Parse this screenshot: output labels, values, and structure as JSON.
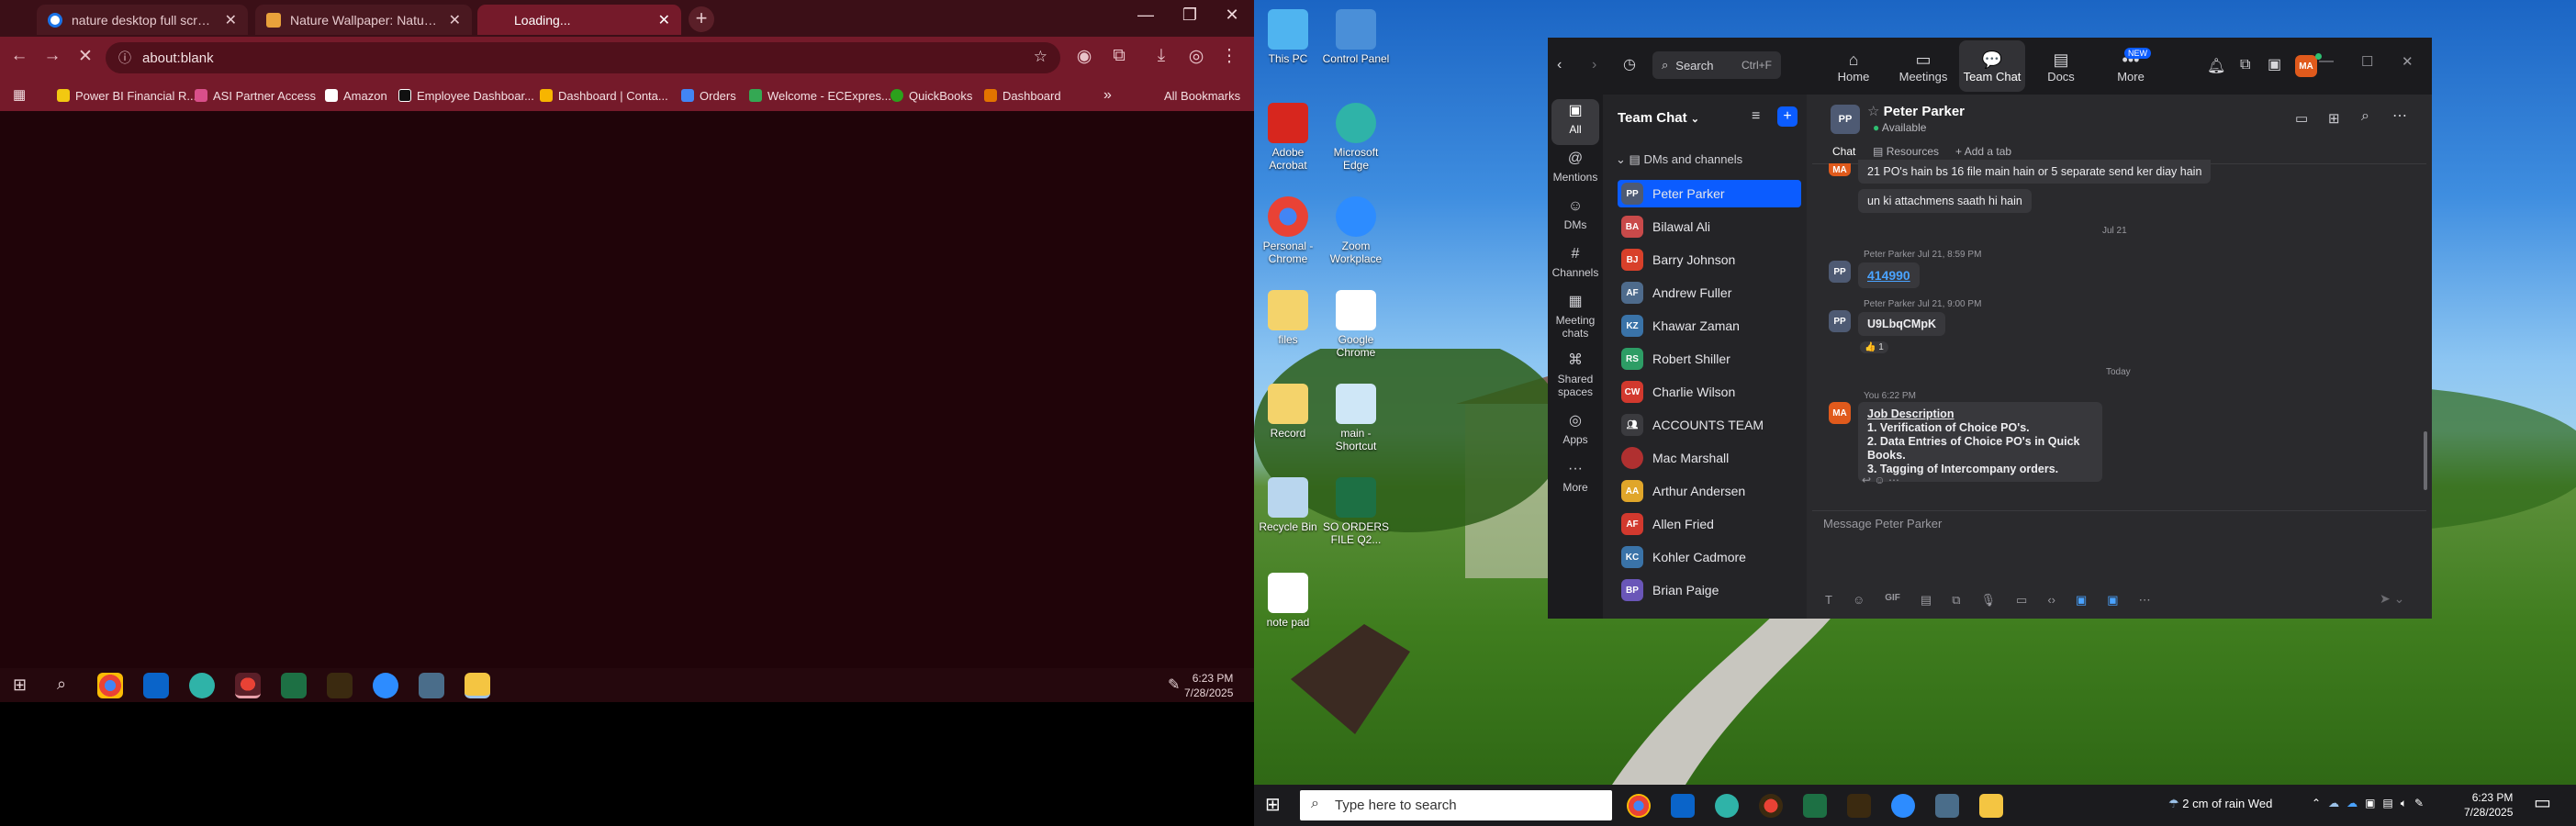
{
  "browser": {
    "tabs": [
      {
        "title": "nature desktop full screen high",
        "color": "#1a73e8"
      },
      {
        "title": "Nature Wallpaper: Nature Wall",
        "color": "#e9a13b"
      },
      {
        "title": "Loading...",
        "color": "#9aa0a6"
      }
    ],
    "address": "about:blank",
    "bookmarks": [
      {
        "label": "Power BI Financial R...",
        "color": "#f2c811"
      },
      {
        "label": "ASI Partner Access",
        "color": "#d94f8a"
      },
      {
        "label": "Amazon",
        "color": "#ffffff"
      },
      {
        "label": "Employee Dashboar...",
        "color": "#111111"
      },
      {
        "label": "Dashboard | Conta...",
        "color": "#f7b500"
      },
      {
        "label": "Orders",
        "color": "#4285f4"
      },
      {
        "label": "Welcome - ECExpres...",
        "color": "#34a853"
      },
      {
        "label": "QuickBooks",
        "color": "#2ca01c"
      },
      {
        "label": "Dashboard",
        "color": "#e37400"
      }
    ],
    "more_bookmarks": "»",
    "all_bookmarks": "All Bookmarks"
  },
  "taskbar_left": {
    "time": "6:23 PM",
    "date": "7/28/2025"
  },
  "desktop_icons": [
    {
      "label": "This PC",
      "color": "#4fb4f0"
    },
    {
      "label": "Control Panel",
      "color": "#4a8fd8"
    },
    {
      "label": "Adobe Acrobat",
      "color": "#d7261e"
    },
    {
      "label": "Microsoft Edge",
      "color": "#2fb3a8"
    },
    {
      "label": "Personal - Chrome",
      "color": "#e94235"
    },
    {
      "label": "Zoom Workplace",
      "color": "#2d8cff"
    },
    {
      "label": "files",
      "color": "#f4d36b"
    },
    {
      "label": "Google Chrome",
      "color": "#ffffff"
    },
    {
      "label": "Record",
      "color": "#f4d36b"
    },
    {
      "label": "main - Shortcut",
      "color": "#cfe7f7"
    },
    {
      "label": "Recycle Bin",
      "color": "#b9d6ee"
    },
    {
      "label": "SO ORDERS FILE Q2...",
      "color": "#1d7044"
    },
    {
      "label": "note pad",
      "color": "#ffffff"
    }
  ],
  "zoom": {
    "search_label": "Search",
    "search_shortcut": "Ctrl+F",
    "nav": [
      {
        "label": "Home",
        "icon": "⌂"
      },
      {
        "label": "Meetings",
        "icon": "▭"
      },
      {
        "label": "Team Chat",
        "icon": "💬"
      },
      {
        "label": "Docs",
        "icon": "▤"
      },
      {
        "label": "More",
        "icon": "•••"
      }
    ],
    "new_badge": "NEW",
    "user_initials": "MA",
    "sidebar": [
      {
        "label": "All",
        "icon": "▣"
      },
      {
        "label": "Mentions",
        "icon": "@"
      },
      {
        "label": "DMs",
        "icon": "☺"
      },
      {
        "label": "Channels",
        "icon": "#"
      },
      {
        "label": "Meeting chats",
        "icon": "▦"
      },
      {
        "label": "Shared spaces",
        "icon": "⌘"
      },
      {
        "label": "Apps",
        "icon": "◎"
      },
      {
        "label": "More",
        "icon": "···"
      }
    ],
    "list_title": "Team Chat",
    "section": "DMs and channels",
    "contacts": [
      {
        "initials": "PP",
        "name": "Peter Parker",
        "color": "#4e5a73"
      },
      {
        "initials": "BA",
        "name": "Bilawal Ali",
        "color": "#c94a4a"
      },
      {
        "initials": "BJ",
        "name": "Barry Johnson",
        "color": "#d8402a"
      },
      {
        "initials": "AF",
        "name": "Andrew Fuller",
        "color": "#4e6b8c"
      },
      {
        "initials": "KZ",
        "name": "Khawar Zaman",
        "color": "#3a73a8"
      },
      {
        "initials": "RS",
        "name": "Robert Shiller",
        "color": "#2d9d65"
      },
      {
        "initials": "CW",
        "name": "Charlie Wilson",
        "color": "#d2392e"
      },
      {
        "initials": "",
        "name": "ACCOUNTS TEAM",
        "color": "#3b3b3f"
      },
      {
        "initials": "",
        "name": "Mac Marshall",
        "color": "#b03030"
      },
      {
        "initials": "AA",
        "name": "Arthur Andersen",
        "color": "#e0a62a"
      },
      {
        "initials": "AF",
        "name": "Allen Fried",
        "color": "#d2392e"
      },
      {
        "initials": "KC",
        "name": "Kohler Cadmore",
        "color": "#3a73a8"
      },
      {
        "initials": "BP",
        "name": "Brian Paige",
        "color": "#6a56b8"
      }
    ],
    "chat": {
      "name": "Peter Parker",
      "initials": "PP",
      "status": "Available",
      "tab_chat": "Chat",
      "tab_resources": "Resources",
      "add_tab": "Add a tab",
      "msg1": "21 PO's hain bs 16 file main hain or 5 separate send ker diay hain",
      "msg2": "un ki attachmens saath hi hain",
      "date_divider": "Jul 21",
      "pp_meta1": "Peter Parker Jul 21, 8:59 PM",
      "pp_msg1": "414990",
      "pp_meta2": "Peter Parker Jul 21, 9:00 PM",
      "pp_msg2": "U9LbqCMpK",
      "reaction": "👍 1",
      "today": "Today",
      "me_meta": "You 6:22 PM",
      "jd_title": "Job Description",
      "jd_1": "1. Verification of Choice PO's.",
      "jd_2": "2. Data Entries of Choice PO's in Quick Books.",
      "jd_3": "3. Tagging of Intercompany orders.",
      "placeholder": "Message Peter Parker"
    }
  },
  "taskbar_right": {
    "search_placeholder": "Type here to search",
    "weather": "2 cm of rain Wed",
    "time": "6:23 PM",
    "date": "7/28/2025"
  }
}
